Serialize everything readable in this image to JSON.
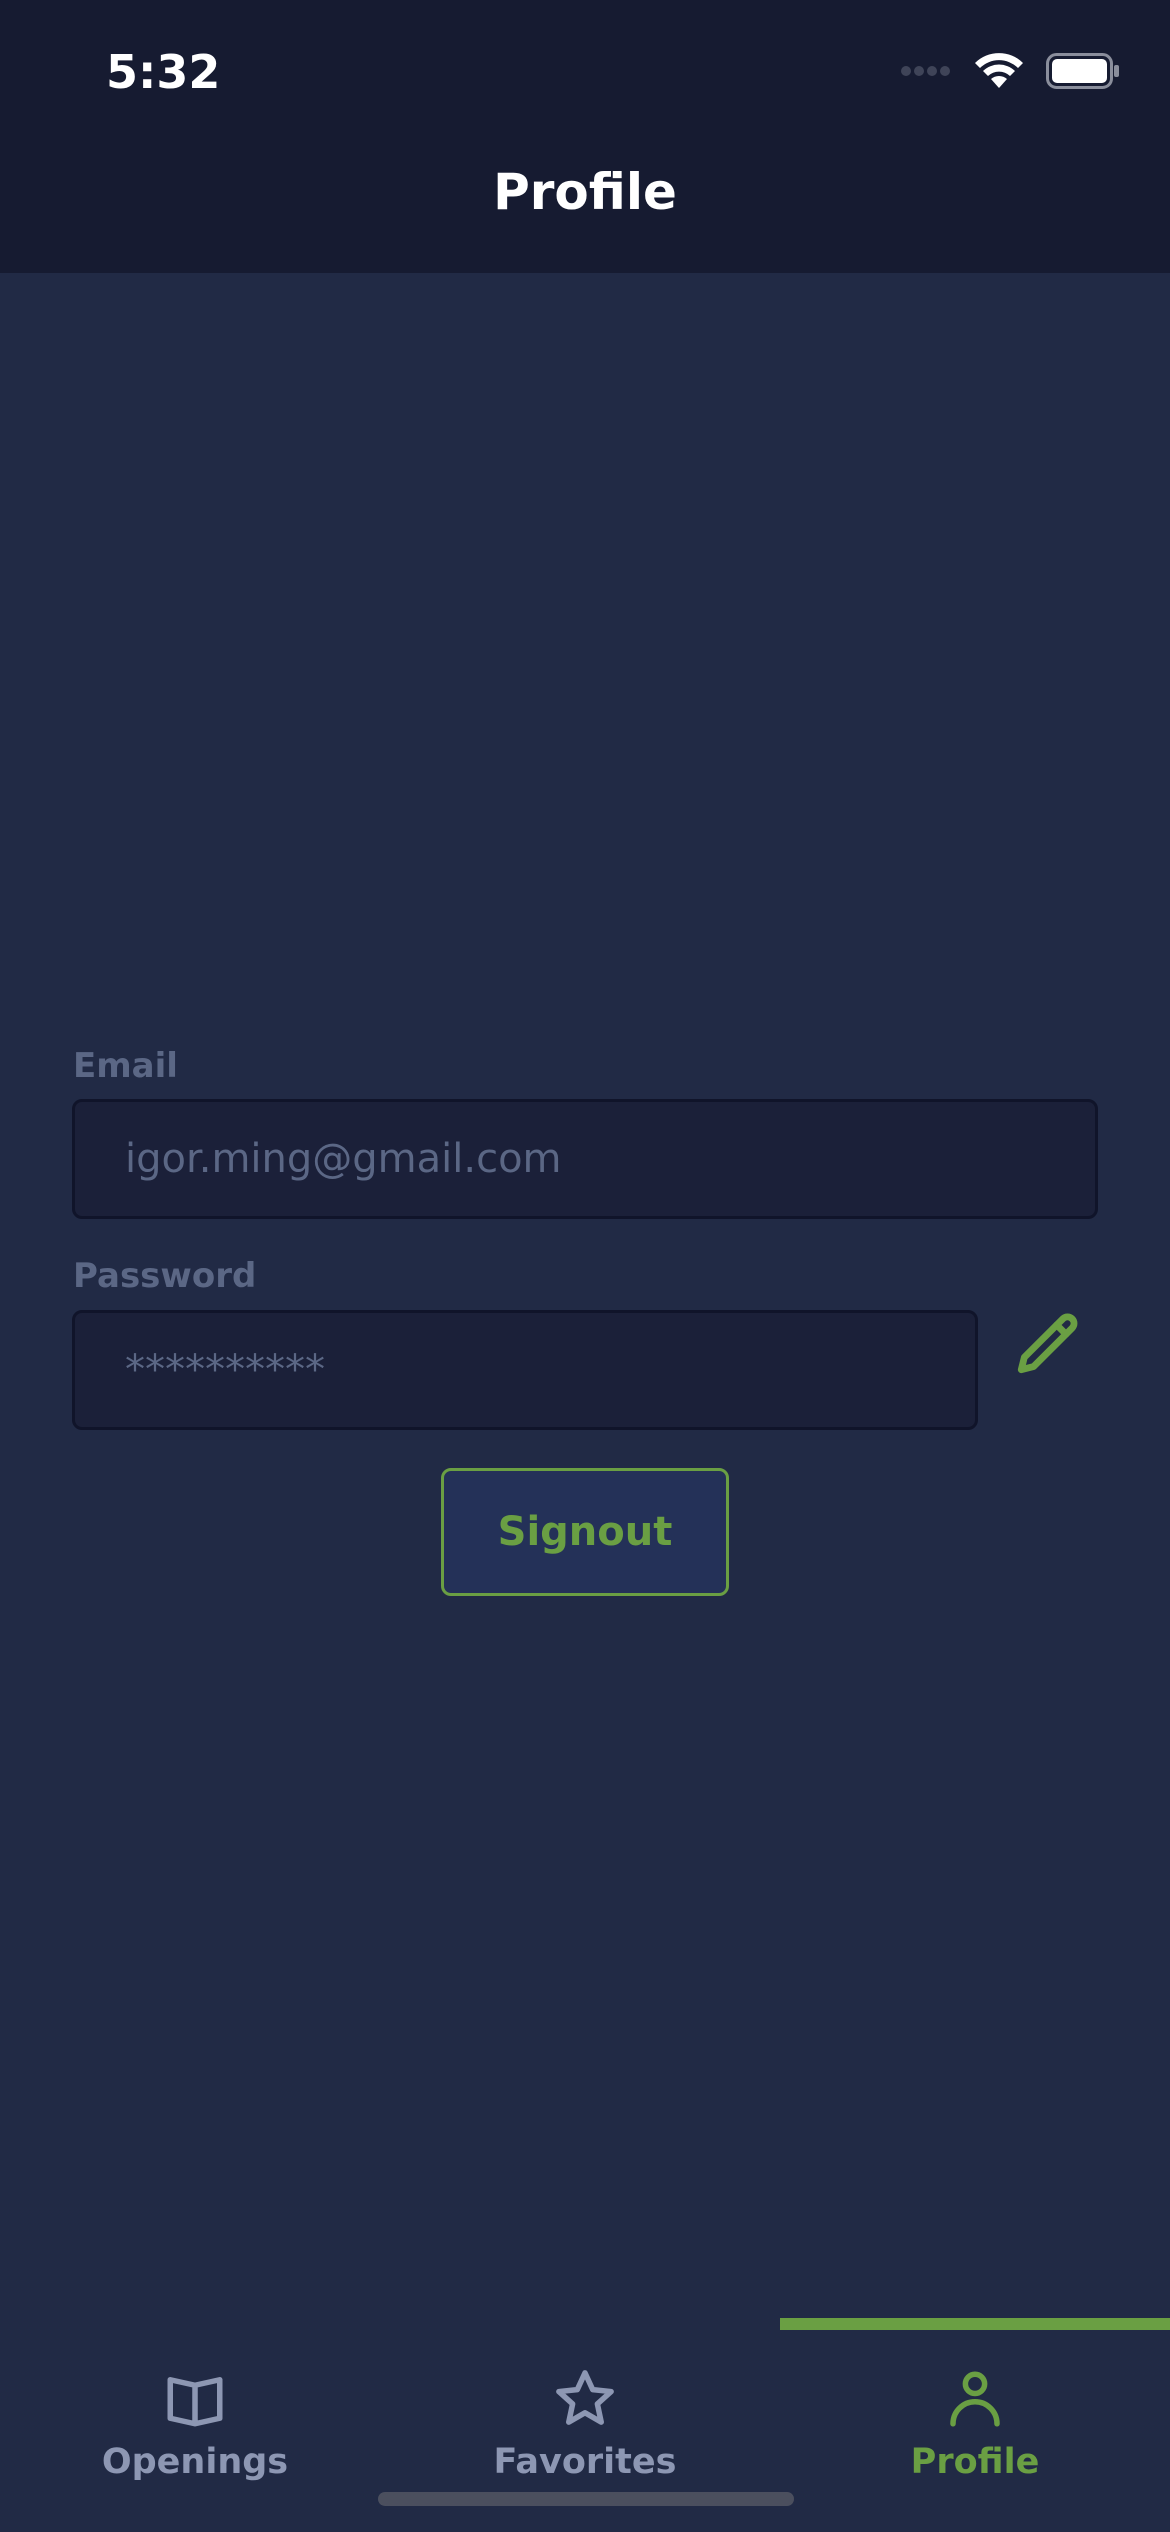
{
  "status_bar": {
    "time": "5:32"
  },
  "header": {
    "title": "Profile"
  },
  "form": {
    "email_label": "Email",
    "email_value": "igor.ming@gmail.com",
    "password_label": "Password",
    "password_value": "**********",
    "signout_label": "Signout"
  },
  "tabs": [
    {
      "label": "Openings",
      "icon": "book-icon",
      "active": false
    },
    {
      "label": "Favorites",
      "icon": "star-icon",
      "active": false
    },
    {
      "label": "Profile",
      "icon": "person-icon",
      "active": true
    }
  ],
  "colors": {
    "background": "#212a45",
    "header": "#161b31",
    "accent": "#6a9f43",
    "input_background": "#1b2039",
    "muted_text": "#5b6785"
  }
}
